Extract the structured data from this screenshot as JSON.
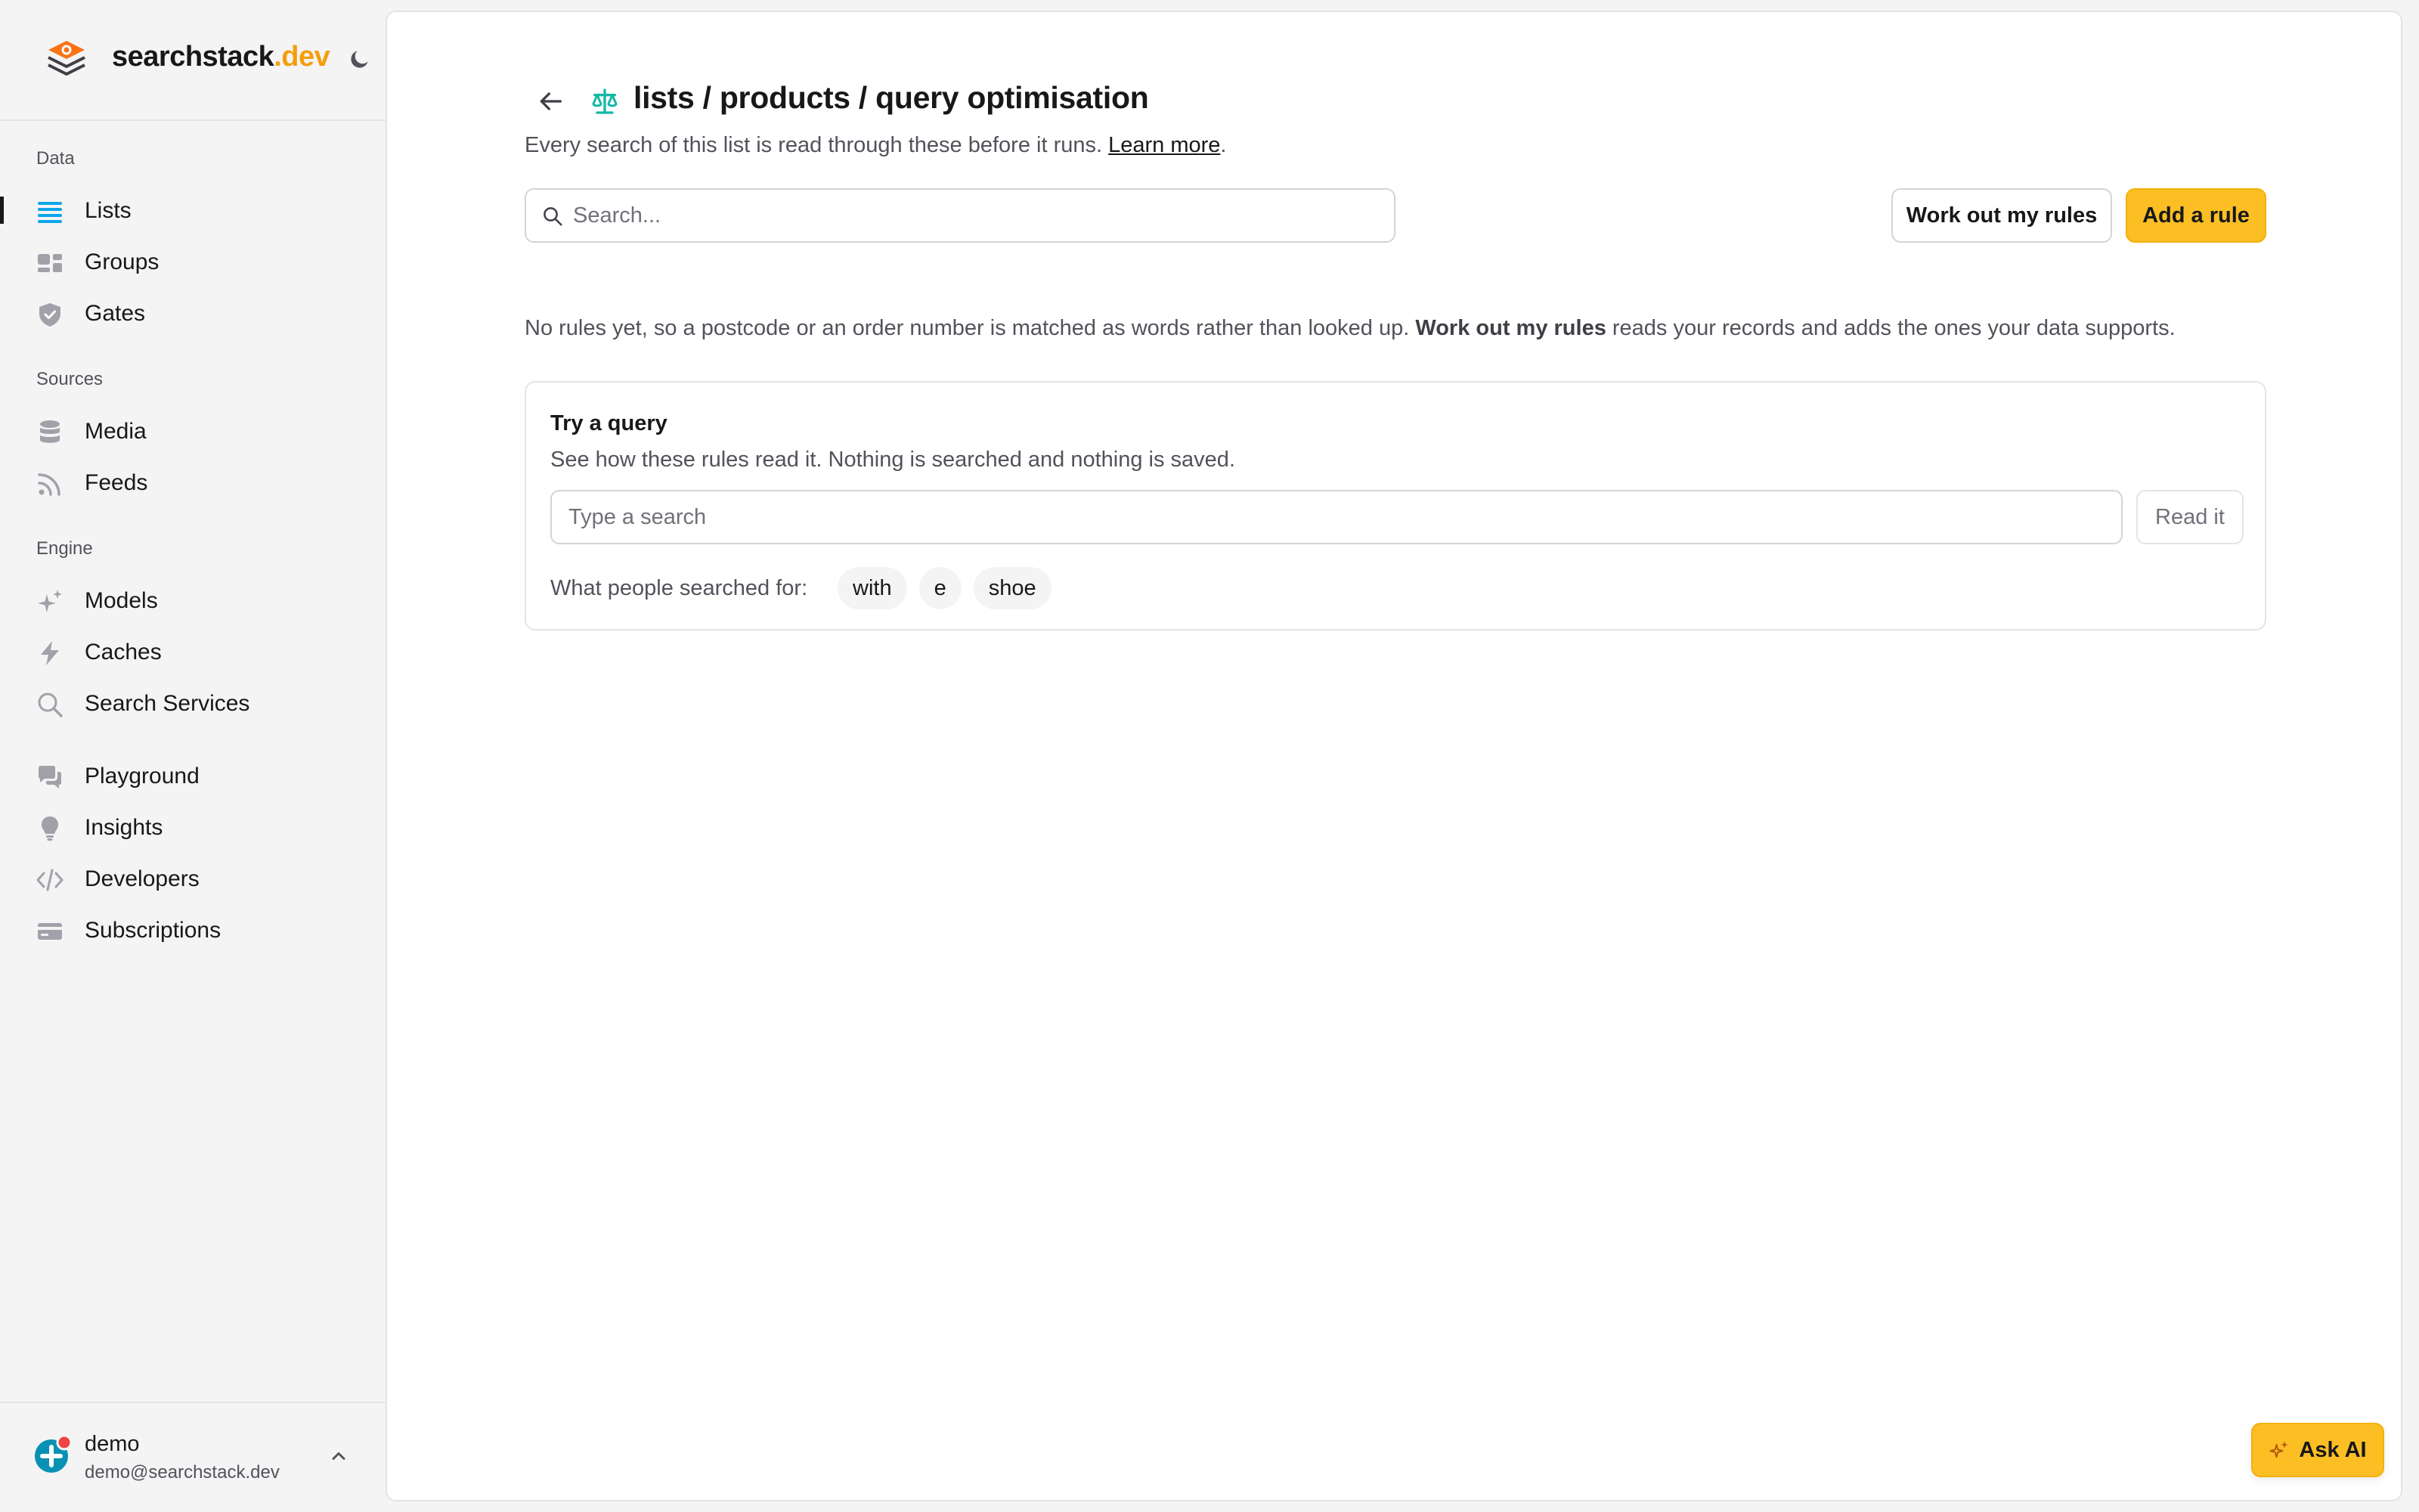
{
  "brand": {
    "name": "searchstack",
    "suffix": ".dev",
    "accent_color": "#f59e0b"
  },
  "sidebar": {
    "sections": [
      {
        "label": "Data",
        "items": [
          {
            "label": "Lists",
            "icon": "list-icon",
            "active": true
          },
          {
            "label": "Groups",
            "icon": "groups-icon"
          },
          {
            "label": "Gates",
            "icon": "shield-icon"
          }
        ]
      },
      {
        "label": "Sources",
        "items": [
          {
            "label": "Media",
            "icon": "database-icon"
          },
          {
            "label": "Feeds",
            "icon": "rss-icon"
          }
        ]
      },
      {
        "label": "Engine",
        "items": [
          {
            "label": "Models",
            "icon": "sparkles-icon"
          },
          {
            "label": "Caches",
            "icon": "bolt-icon"
          },
          {
            "label": "Search Services",
            "icon": "search-icon"
          }
        ]
      },
      {
        "label": "",
        "items": [
          {
            "label": "Playground",
            "icon": "chat-icon"
          },
          {
            "label": "Insights",
            "icon": "lightbulb-icon"
          },
          {
            "label": "Developers",
            "icon": "code-icon"
          },
          {
            "label": "Subscriptions",
            "icon": "credit-card-icon"
          }
        ]
      }
    ]
  },
  "user": {
    "name": "demo",
    "email": "demo@searchstack.dev"
  },
  "header": {
    "title": "lists / products / query optimisation",
    "subtitle": "Every search of this list is read through these before it runs.",
    "learn_more": "Learn more",
    "subtitle_end": "."
  },
  "toolbar": {
    "search_placeholder": "Search...",
    "work_out_label": "Work out my rules",
    "add_rule_label": "Add a rule"
  },
  "info": {
    "text_before": "No rules yet, so a postcode or an order number is matched as words rather than looked up. ",
    "bold": "Work out my rules",
    "text_after": " reads your records and adds the ones your data supports."
  },
  "try_query": {
    "title": "Try a query",
    "description": "See how these rules read it. Nothing is searched and nothing is saved.",
    "input_placeholder": "Type a search",
    "read_button": "Read it",
    "searched_label": "What people searched for:",
    "chips": [
      "with",
      "e",
      "shoe"
    ]
  },
  "ask_ai": {
    "label": "Ask AI"
  },
  "colors": {
    "primary": "#fbbf24",
    "teal_icon": "#14b8a6",
    "list_icon": "#0ea5e9",
    "badge_red": "#ef4444"
  }
}
